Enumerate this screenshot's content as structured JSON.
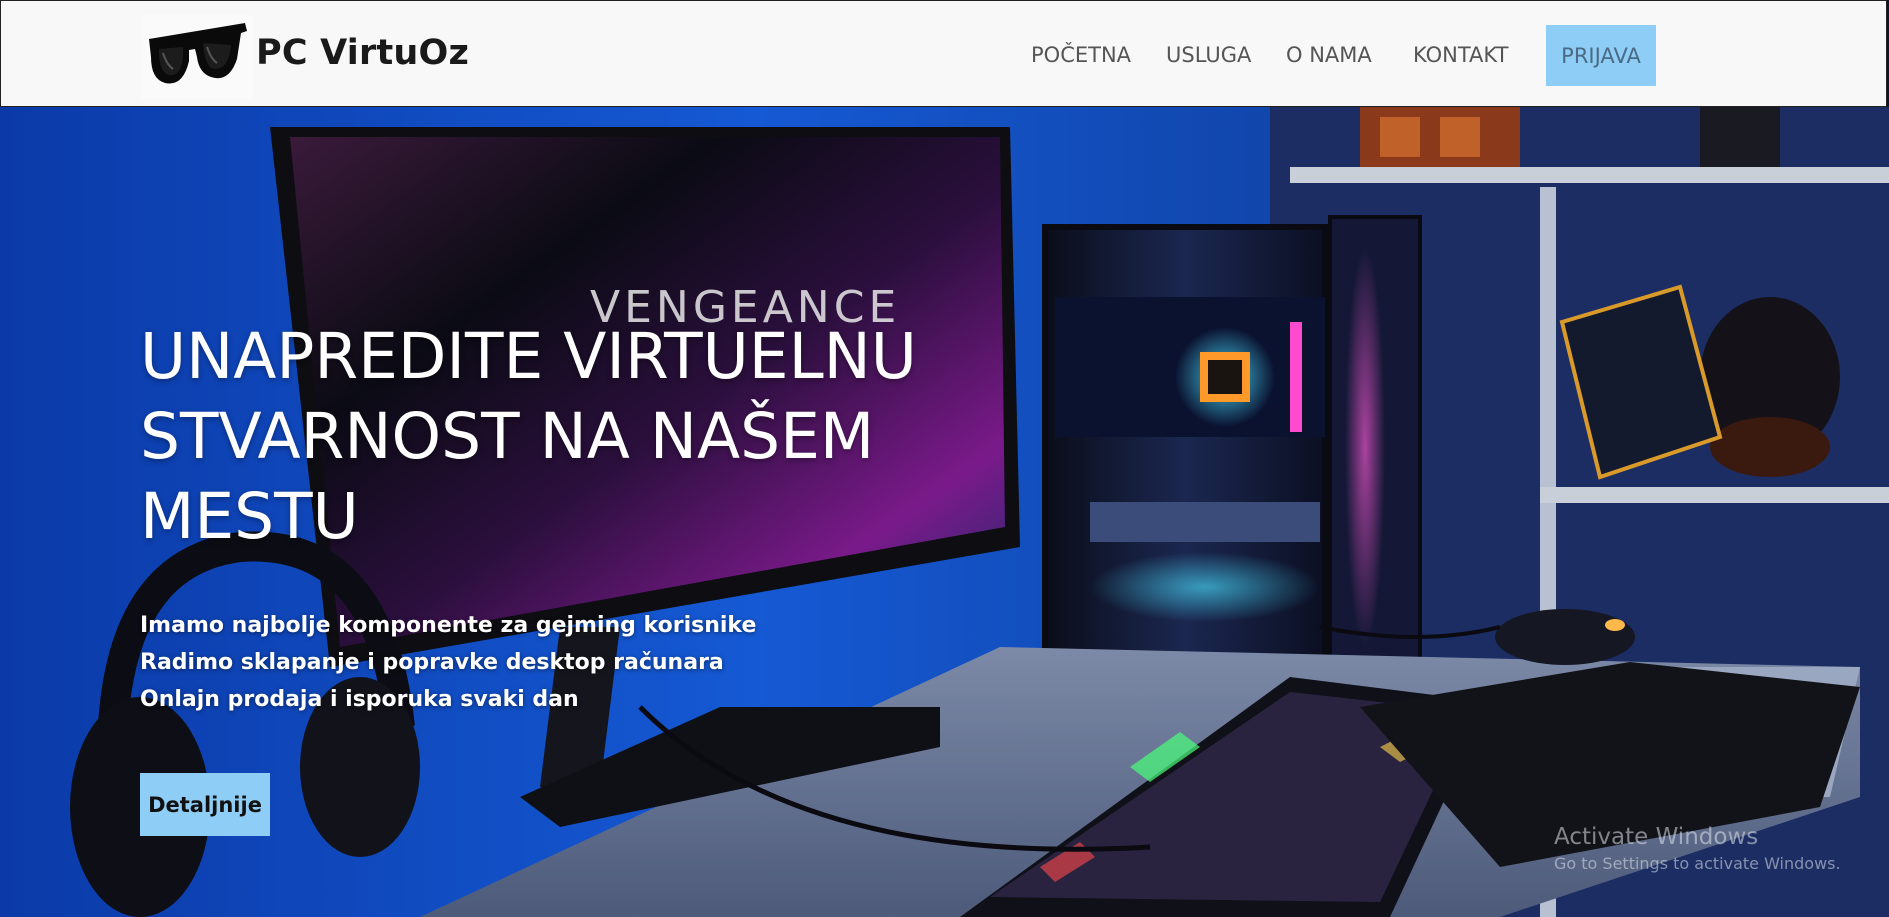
{
  "header": {
    "brand": "PC VirtuOz",
    "logo_icon": "sunglasses-icon",
    "nav": [
      {
        "label": "POČETNA"
      },
      {
        "label": "USLUGA"
      },
      {
        "label": "O NAMA"
      },
      {
        "label": "KONTAKT"
      }
    ],
    "login_label": "PRIJAVA",
    "accent_color": "#8ecdf5"
  },
  "hero": {
    "title": "UNAPREDITE VIRTUELNU STVARNOST NA NAŠEM MESTU",
    "lines": [
      "Imamo najbolje komponente za gejming korisnike",
      "Radimo sklapanje i popravke desktop računara",
      "Onlajn prodaja i isporuka svaki dan"
    ],
    "cta_label": "Detaljnije",
    "background": "gaming-desk-photo"
  },
  "watermark": {
    "line1": "Activate Windows",
    "line2": "Go to Settings to activate Windows."
  }
}
